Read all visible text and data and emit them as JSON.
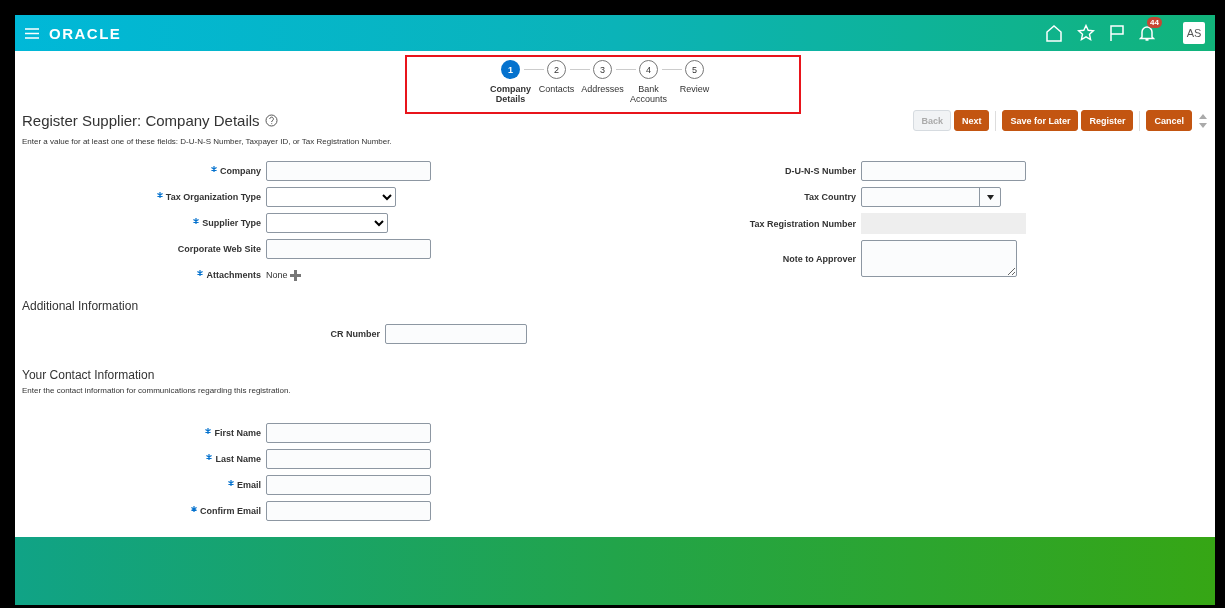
{
  "header": {
    "logo": "ORACLE",
    "notification_count": "44",
    "avatar": "AS"
  },
  "train": {
    "steps": [
      {
        "number": "1",
        "label": "Company Details",
        "selected": true
      },
      {
        "number": "2",
        "label": "Contacts",
        "selected": false
      },
      {
        "number": "3",
        "label": "Addresses",
        "selected": false
      },
      {
        "number": "4",
        "label": "Bank Accounts",
        "selected": false
      },
      {
        "number": "5",
        "label": "Review",
        "selected": false
      }
    ]
  },
  "title": "Register Supplier: Company Details",
  "buttons": [
    {
      "label": "Back",
      "kind": "secondary",
      "disabled": true
    },
    {
      "label": "Next",
      "kind": "primary",
      "disabled": false
    },
    {
      "label": "Save for Later",
      "kind": "primary",
      "disabled": false
    },
    {
      "label": "Register",
      "kind": "primary",
      "disabled": false
    },
    {
      "label": "Cancel",
      "kind": "primary",
      "disabled": false
    }
  ],
  "instruction": "Enter a value for at least one of these fields: D-U-N-S Number, Taxpayer ID, or Tax Registration Number.",
  "left_fields": [
    {
      "label": "Company",
      "required": true,
      "kind": "text"
    },
    {
      "label": "Tax Organization Type",
      "required": true,
      "kind": "select"
    },
    {
      "label": "Supplier Type",
      "required": true,
      "kind": "select"
    },
    {
      "label": "Corporate Web Site",
      "required": false,
      "kind": "text"
    },
    {
      "label": "Attachments",
      "required": true,
      "kind": "attachments",
      "value": "None"
    }
  ],
  "right_fields": [
    {
      "label": "D-U-N-S Number",
      "required": false,
      "kind": "text"
    },
    {
      "label": "Tax Country",
      "required": false,
      "kind": "combo"
    },
    {
      "label": "Tax Registration Number",
      "required": false,
      "kind": "readonly"
    },
    {
      "label": "Note to Approver",
      "required": false,
      "kind": "textarea"
    }
  ],
  "additional": {
    "heading": "Additional Information",
    "fields": [
      {
        "label": "CR Number",
        "required": false,
        "kind": "text"
      }
    ]
  },
  "contact": {
    "heading": "Your Contact Information",
    "text": "Enter the contact information for communications regarding this registration.",
    "fields": [
      {
        "label": "First Name",
        "required": true,
        "kind": "text"
      },
      {
        "label": "Last Name",
        "required": true,
        "kind": "text"
      },
      {
        "label": "Email",
        "required": true,
        "kind": "text"
      },
      {
        "label": "Confirm Email",
        "required": true,
        "kind": "text"
      }
    ]
  }
}
